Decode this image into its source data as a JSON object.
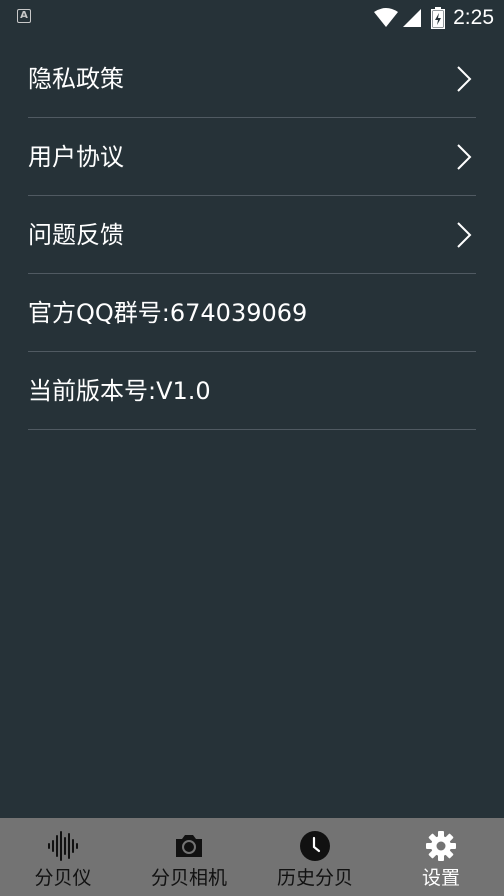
{
  "status_bar": {
    "time": "2:25",
    "app_icon_letter": "A"
  },
  "settings": {
    "items": [
      {
        "label": "隐私政策",
        "has_arrow": true
      },
      {
        "label": "用户协议",
        "has_arrow": true
      },
      {
        "label": "问题反馈",
        "has_arrow": true
      },
      {
        "label": "官方QQ群号:674039069",
        "has_arrow": false
      },
      {
        "label": "当前版本号:V1.0",
        "has_arrow": false
      }
    ]
  },
  "bottom_nav": {
    "items": [
      {
        "label": "分贝仪",
        "icon": "waveform-icon",
        "active": false
      },
      {
        "label": "分贝相机",
        "icon": "camera-icon",
        "active": false
      },
      {
        "label": "历史分贝",
        "icon": "clock-icon",
        "active": false
      },
      {
        "label": "设置",
        "icon": "gear-icon",
        "active": true
      }
    ]
  },
  "colors": {
    "background": "#263238",
    "divider": "#505a62",
    "nav_background": "#737373",
    "nav_inactive": "#111111",
    "nav_active": "#ffffff"
  }
}
